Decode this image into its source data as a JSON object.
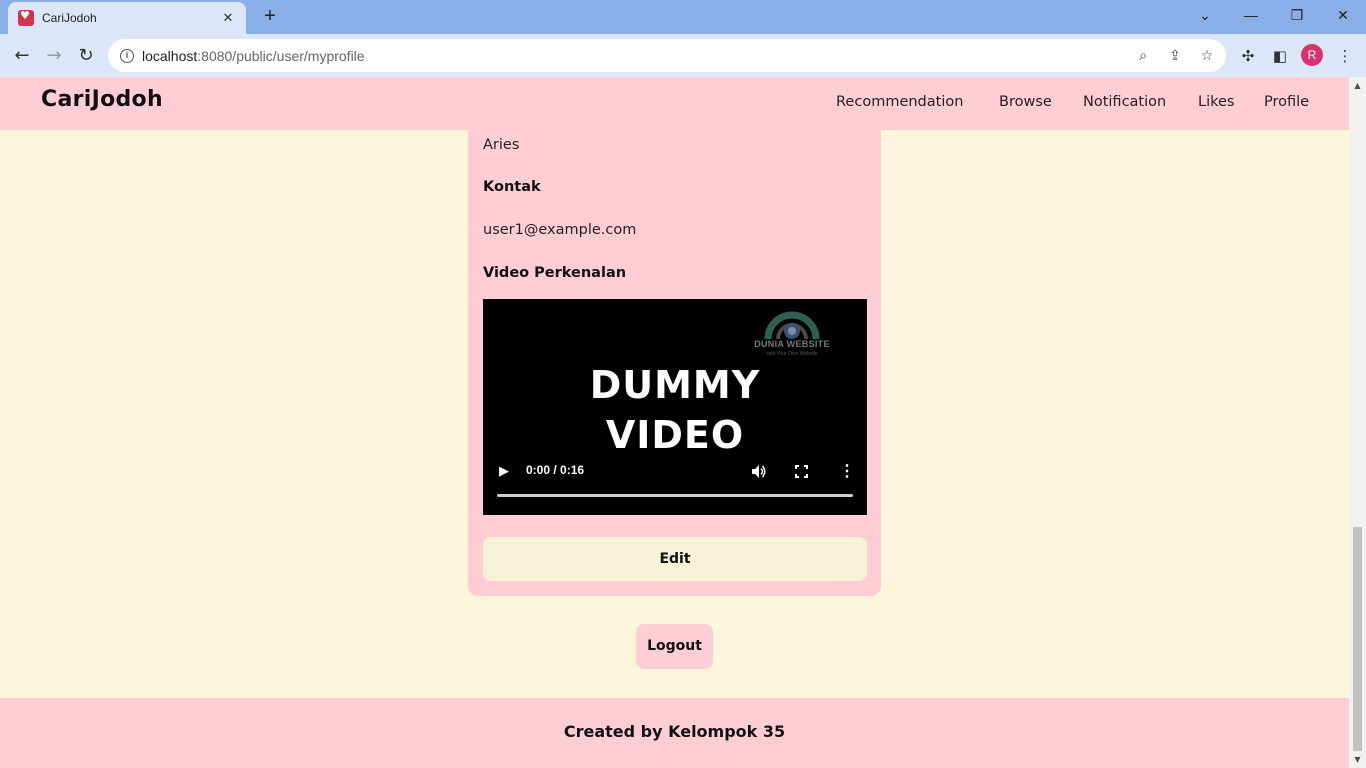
{
  "browser": {
    "tab_title": "CariJodoh",
    "url_host": "localhost",
    "url_path": ":8080/public/user/myprofile",
    "profile_initial": "R"
  },
  "site": {
    "brand": "CariJodoh",
    "nav": [
      "Recommendation",
      "Browse",
      "Notification",
      "Likes",
      "Profile"
    ]
  },
  "profile": {
    "zodiac": "Aries",
    "contact_label": "Kontak",
    "contact_value": "user1@example.com",
    "video_label": "Video Perkenalan",
    "video": {
      "title_line1": "DUMMY",
      "title_line2": "VIDEO",
      "watermark": "DUNIA WEBSITE",
      "watermark_sub": "web Your Own Website",
      "time": "0:00 / 0:16",
      "progress": 0
    },
    "edit_label": "Edit"
  },
  "logout_label": "Logout",
  "footer": "Created by Kelompok 35",
  "colors": {
    "pink": "#ffcdd6",
    "cream": "#fbf6dc",
    "chrome_blue": "#8aaee8"
  }
}
